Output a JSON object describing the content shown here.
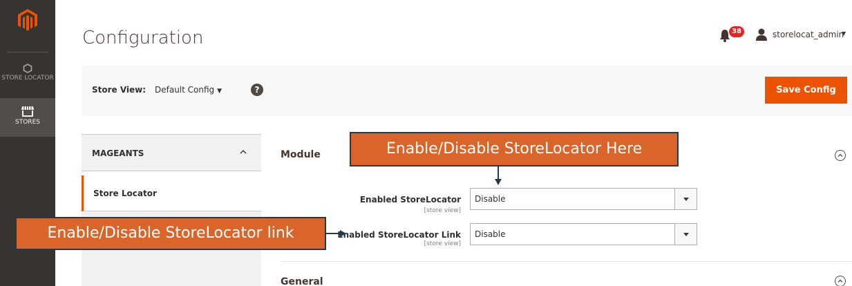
{
  "header": {
    "page_title": "Configuration",
    "notification_count": "38",
    "username": "storelocat_admin"
  },
  "sidebar": {
    "items": [
      {
        "label": "STORE LOCATOR",
        "icon": "hexagon-icon"
      },
      {
        "label": "STORES",
        "icon": "store-icon"
      }
    ]
  },
  "scope": {
    "label": "Store View:",
    "value": "Default Config",
    "save_label": "Save Config"
  },
  "tabs": {
    "group_title": "MAGEANTS",
    "active_item": "Store Locator"
  },
  "sections": {
    "module_title": "Module",
    "general_title": "General"
  },
  "fields": [
    {
      "label": "Enabled StoreLocator",
      "scope": "[store view]",
      "value": "Disable"
    },
    {
      "label": "Enabled StoreLocator Link",
      "scope": "[store view]",
      "value": "Disable"
    }
  ],
  "annotations": {
    "top": "Enable/Disable StoreLocator Here",
    "left": "Enable/Disable StoreLocator link"
  },
  "colors": {
    "accent": "#eb5202",
    "sidebar": "#373330",
    "callout": "#d9652b"
  }
}
